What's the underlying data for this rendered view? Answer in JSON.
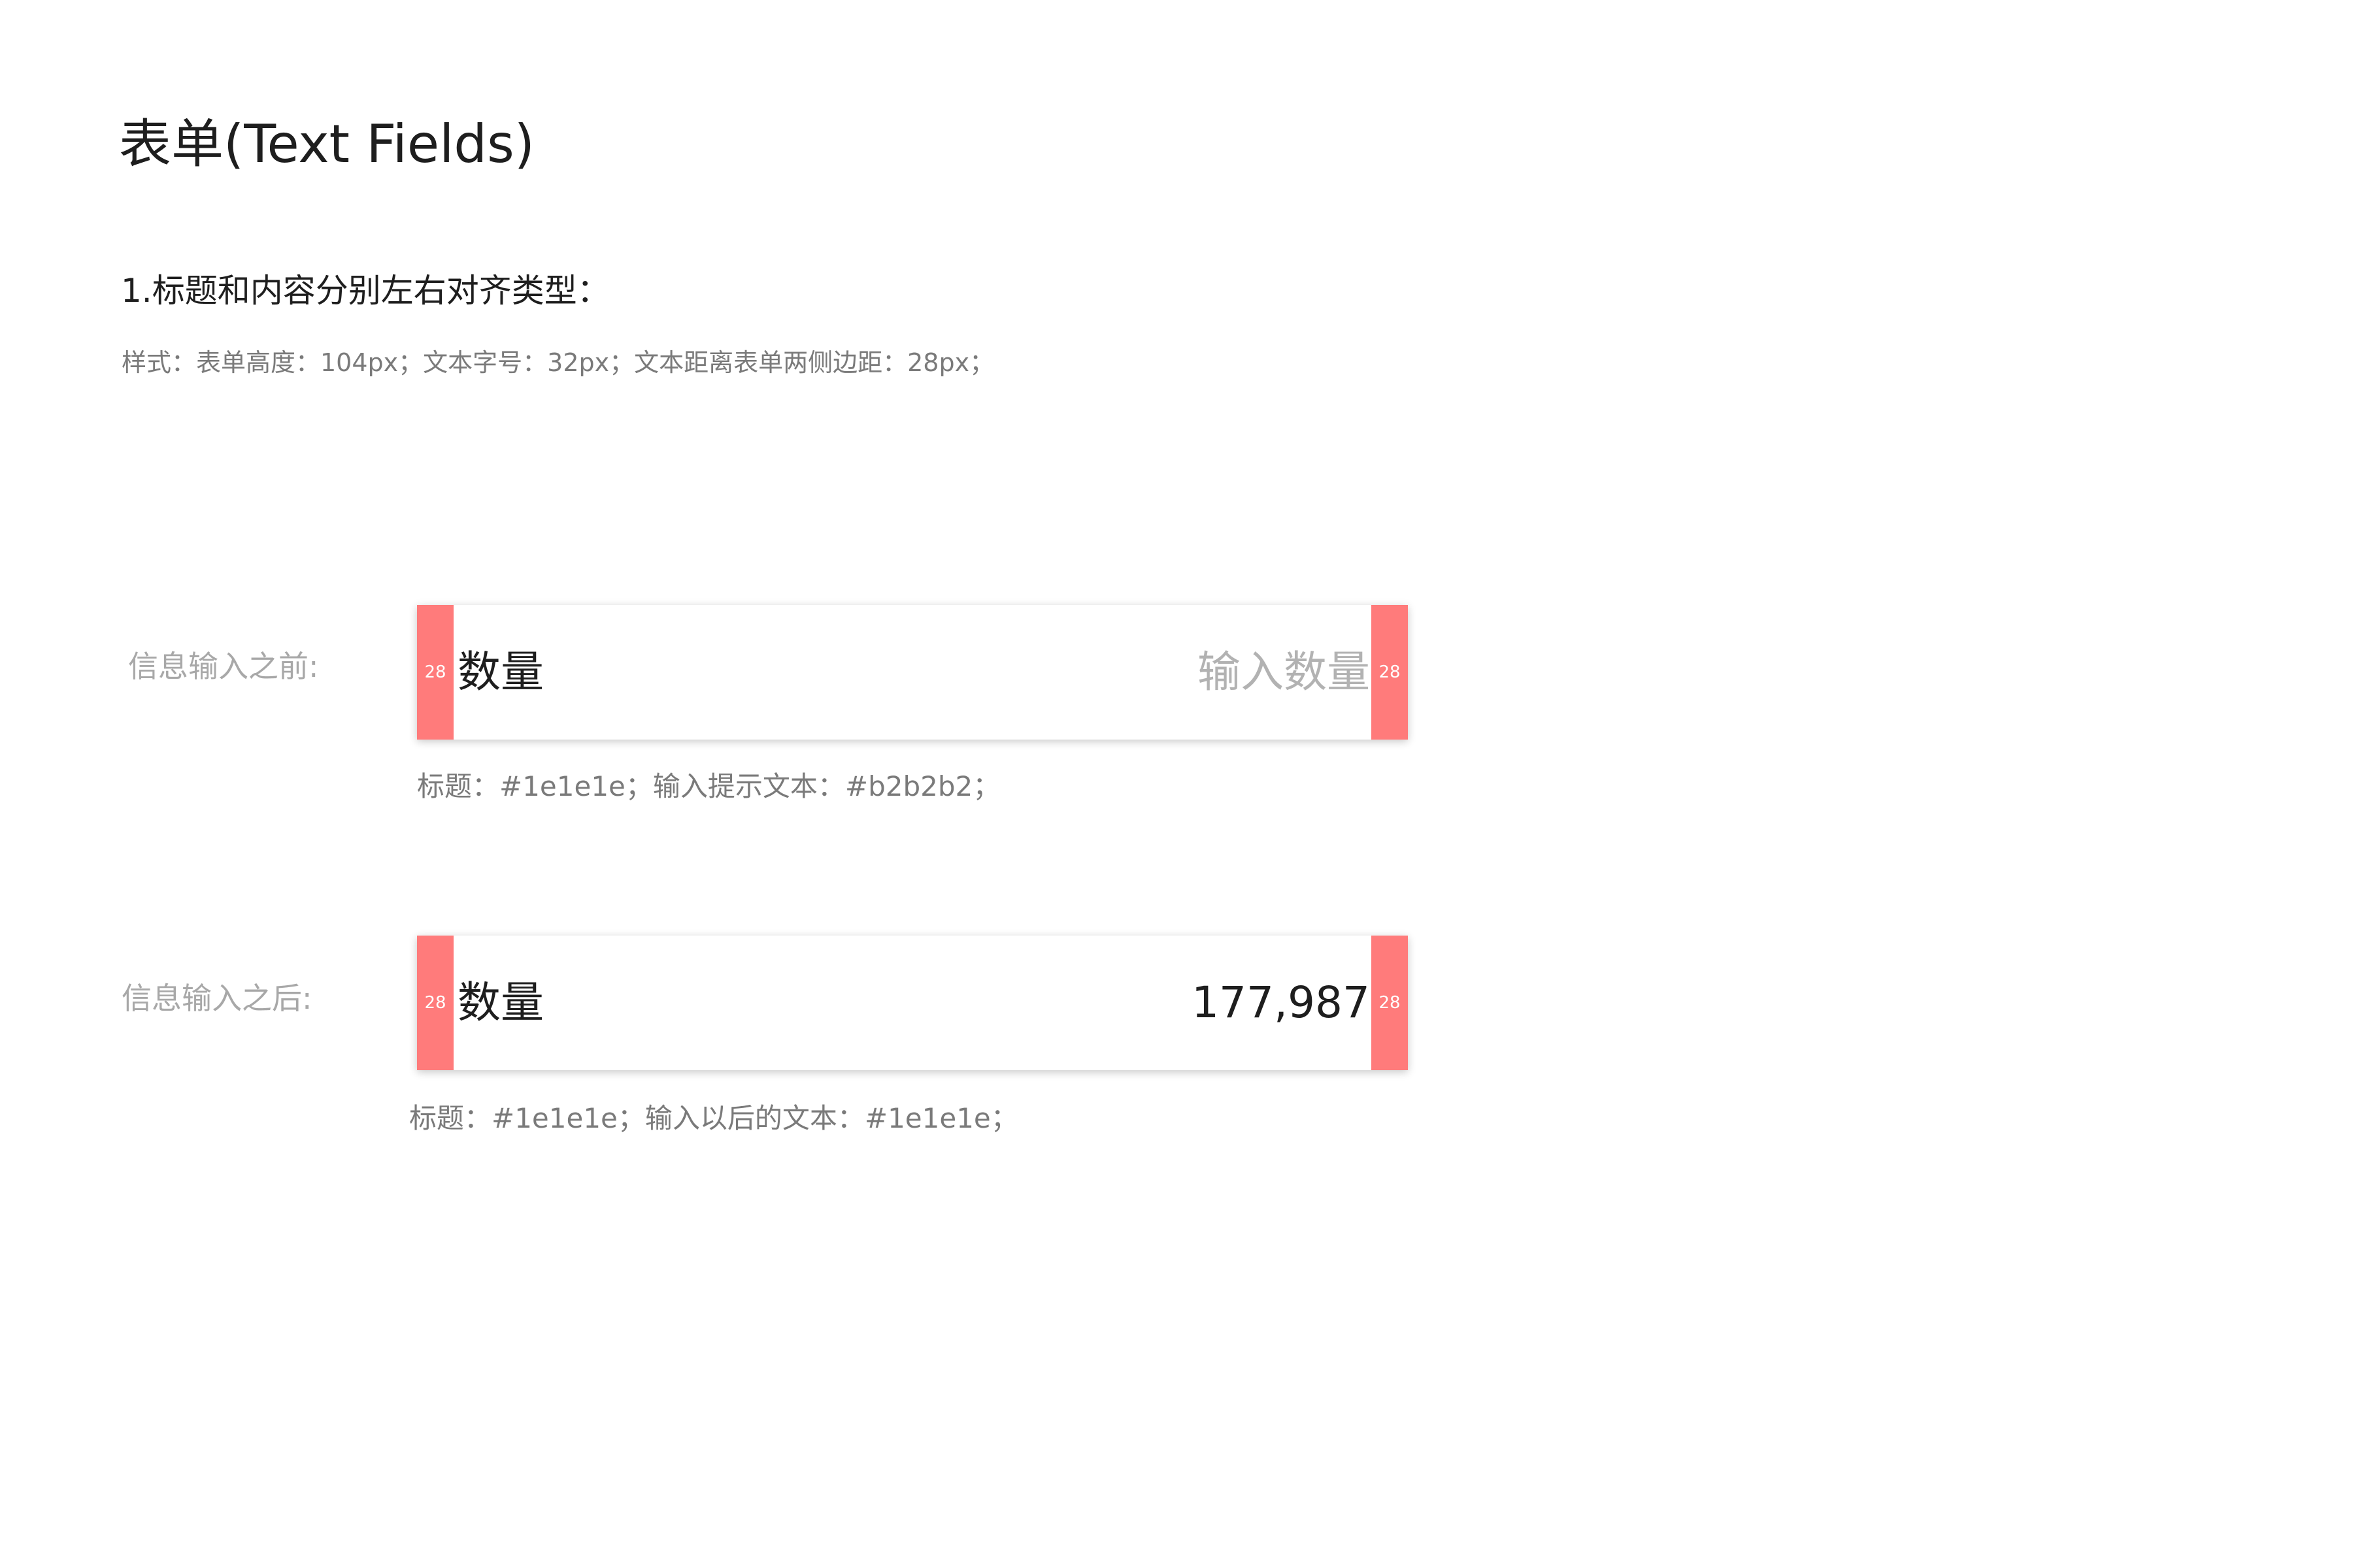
{
  "page": {
    "title": "表单(Text Fields)"
  },
  "section": {
    "heading": "1.标题和内容分别左右对齐类型：",
    "description": "样式：表单高度：104px；文本字号：32px；文本距离表单两侧边距：28px；"
  },
  "before": {
    "label": "信息输入之前:",
    "pad_left": "28",
    "pad_right": "28",
    "title": "数量",
    "placeholder": "输入数量",
    "note": "标题：#1e1e1e；输入提示文本：#b2b2b2；"
  },
  "after": {
    "label": "信息输入之后:",
    "pad_left": "28",
    "pad_right": "28",
    "title": "数量",
    "value": "177,987",
    "note": "标题：#1e1e1e；输入以后的文本：#1e1e1e；"
  },
  "colors": {
    "title_text": "#1e1e1e",
    "placeholder_text": "#b2b2b2",
    "padding_marker": "#ff7b7b"
  }
}
